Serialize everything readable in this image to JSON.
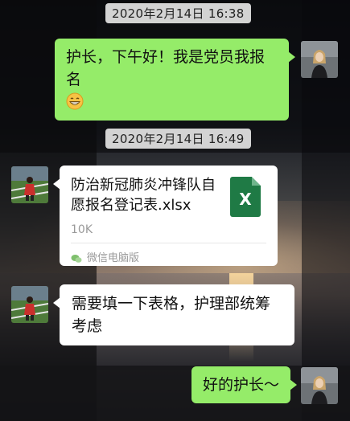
{
  "messages": {
    "ts1": "2020年2月14日 16:38",
    "msg1_text": "护长，下午好！我是党员我报名",
    "msg1_emoji": "grinning-face-icon",
    "ts2": "2020年2月14日 16:49",
    "file": {
      "name": "防治新冠肺炎冲锋队自愿报名登记表.xlsx",
      "size": "10K",
      "icon": "X",
      "source": "微信电脑版"
    },
    "msg3_text": "需要填一下表格，护理部统筹考虑",
    "msg4_text": "好的护长～"
  },
  "colors": {
    "sent_bubble": "#95ec69",
    "received_bubble": "#ffffff",
    "excel_green": "#1f7a45",
    "timestamp_bg": "#d3d3d3"
  }
}
